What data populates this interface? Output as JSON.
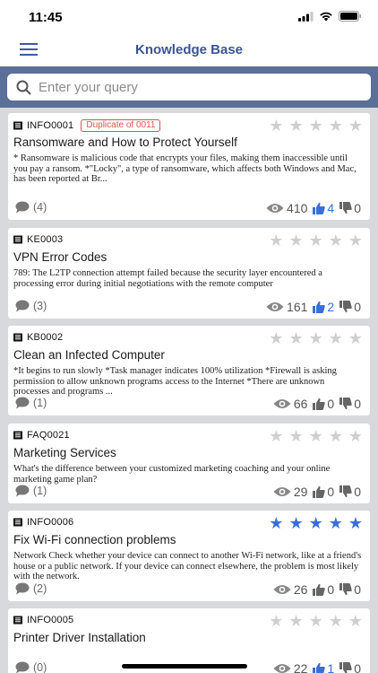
{
  "status": {
    "time": "11:45"
  },
  "header": {
    "title": "Knowledge Base"
  },
  "search": {
    "placeholder": "Enter your query"
  },
  "colors": {
    "accent": "#3a6fd8",
    "nav_title": "#3b5592",
    "search_band": "#5b6f99",
    "duplicate": "#d9534f"
  },
  "articles": [
    {
      "id": "INFO0001",
      "badge": "Duplicate of 0011",
      "title": "Ransomware and How to Protect Yourself",
      "body": "* Ransomware is malicious code that encrypts your files, making them inaccessible until you pay a ransom. *\"Locky\", a type of ransomware, which affects both Windows and Mac, has been reported at Br...",
      "comments": "(4)",
      "views": "410",
      "likes": "4",
      "dislikes": "0",
      "rating": 0
    },
    {
      "id": "KE0003",
      "title": "VPN Error Codes",
      "body": "789: The L2TP connection attempt failed because the security layer encountered a processing error during initial negotiations with the remote computer",
      "comments": "(3)",
      "views": "161",
      "likes": "2",
      "dislikes": "0",
      "rating": 0
    },
    {
      "id": "KB0002",
      "title": "Clean an Infected Computer",
      "body": "*It begins to run slowly *Task manager indicates 100% utilization *Firewall is asking permission to allow unknown programs access to the Internet *There are unknown processes and programs ...",
      "comments": "(1)",
      "views": "66",
      "likes": "0",
      "dislikes": "0",
      "rating": 0
    },
    {
      "id": "FAQ0021",
      "title": "Marketing Services",
      "body": "What's the difference between your customized marketing coaching and your online marketing game plan?",
      "comments": "(1)",
      "views": "29",
      "likes": "0",
      "dislikes": "0",
      "rating": 0
    },
    {
      "id": "INFO0006",
      "title": "Fix Wi-Fi connection problems",
      "body": "Network Check whether your device can connect to another Wi-Fi network, like at a friend's house or a public network. If your device can connect elsewhere, the problem is most likely with the network.",
      "comments": "(2)",
      "views": "26",
      "likes": "0",
      "dislikes": "0",
      "rating": 5
    },
    {
      "id": "INFO0005",
      "title": "Printer Driver Installation",
      "body": "",
      "comments": "(0)",
      "views": "22",
      "likes": "1",
      "dislikes": "0",
      "rating": 0
    }
  ]
}
